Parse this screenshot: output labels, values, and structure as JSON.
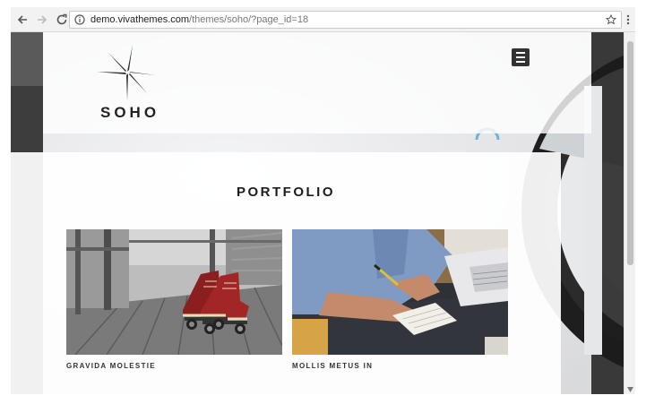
{
  "browser": {
    "url_host": "demo.vivathemes.com",
    "url_path": "/themes/soho/?page_id=18",
    "icons": [
      "back-arrow-icon",
      "forward-arrow-icon",
      "reload-icon",
      "info-icon",
      "star-icon",
      "more-vert-icon"
    ]
  },
  "site": {
    "logo_text": "SOHO",
    "menu_icon": "hamburger-icon"
  },
  "page": {
    "title": "PORTFOLIO",
    "items": [
      {
        "caption": "GRAVIDA MOLESTIE",
        "image": "roller-skates-on-wooden-deck"
      },
      {
        "caption": "MOLLIS METUS IN",
        "image": "person-writing-at-laptop-desk"
      }
    ]
  },
  "colors": {
    "accent_dark": "#222222",
    "chrome_bg": "#f2f2f2",
    "skate_red": "#8b1f1f"
  }
}
